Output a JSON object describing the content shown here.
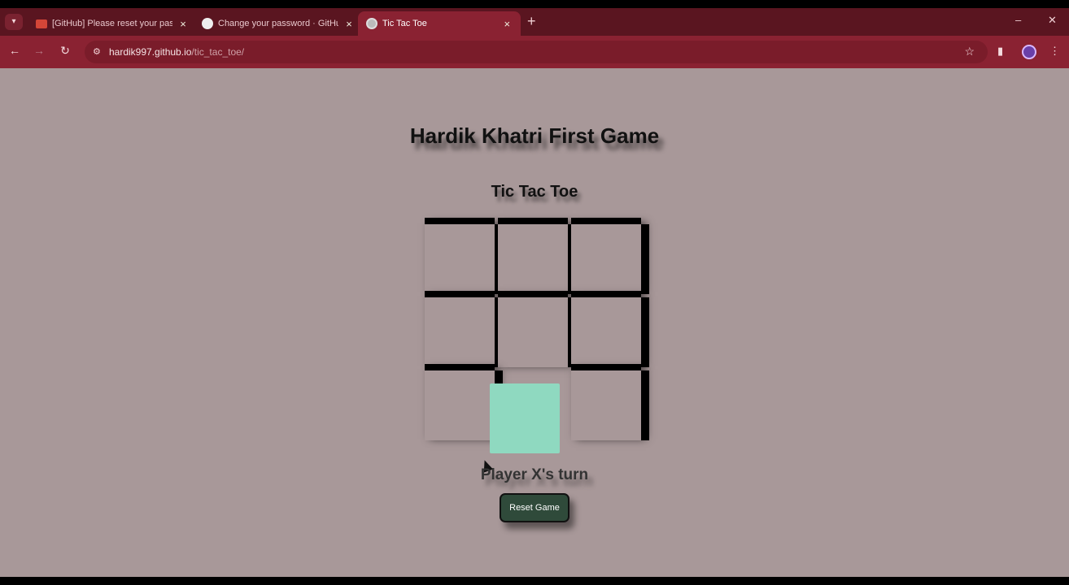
{
  "browser": {
    "tabs": [
      {
        "title": "[GitHub] Please reset your pas",
        "favicon": "gmail-icon"
      },
      {
        "title": "Change your password · GitHub",
        "favicon": "github-icon"
      },
      {
        "title": "Tic Tac Toe",
        "favicon": "globe-icon"
      }
    ],
    "url_host": "hardik997.github.io",
    "url_path": "/tic_tac_toe/"
  },
  "page": {
    "title": "Hardik Khatri First Game",
    "subtitle": "Tic Tac Toe",
    "turn_text": "Player X's turn",
    "reset_label": "Reset Game"
  },
  "board": {
    "cells": [
      "",
      "",
      "",
      "",
      "",
      "",
      "",
      "",
      ""
    ],
    "hovered_cell_index": 7,
    "hover_color": "#8fd9c0",
    "background": "#a89899",
    "grid_color": "#000000"
  },
  "theme": {
    "browser_frame": "#8a2232",
    "button_bg": "#2f4a3a"
  }
}
